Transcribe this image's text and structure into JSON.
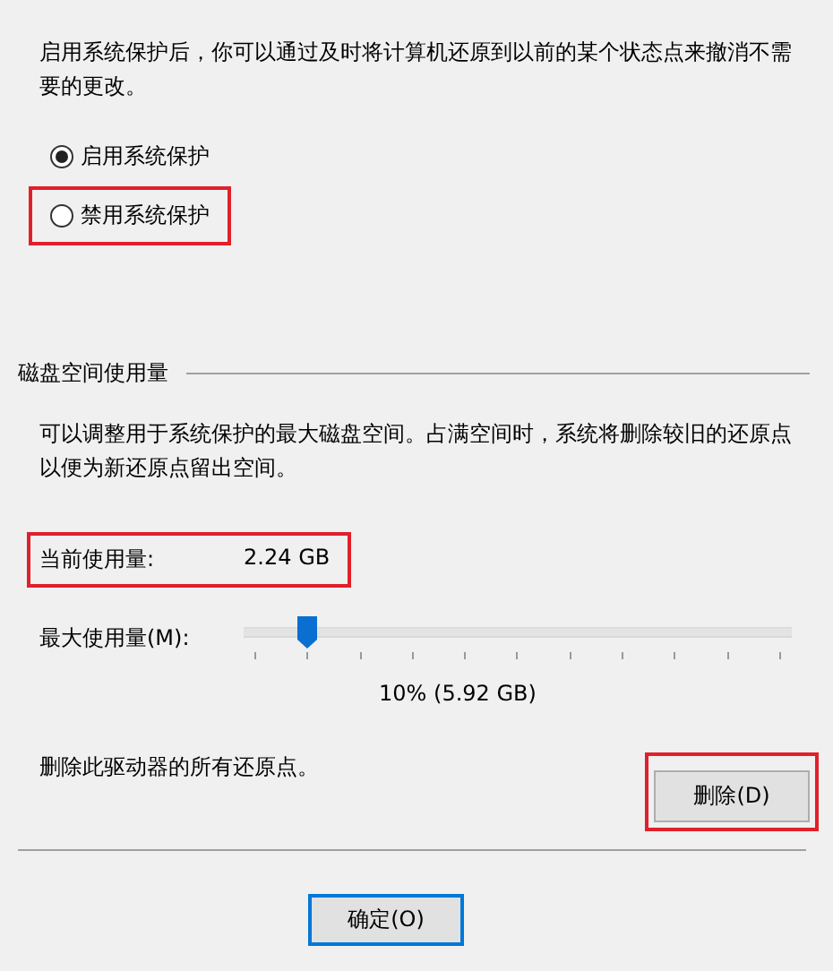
{
  "description": "启用系统保护后，你可以通过及时将计算机还原到以前的某个状态点来撤消不需要的更改。",
  "radios": [
    {
      "label": "启用系统保护",
      "selected": true,
      "highlighted": false
    },
    {
      "label": "禁用系统保护",
      "selected": false,
      "highlighted": true
    }
  ],
  "disk_usage": {
    "heading": "磁盘空间使用量",
    "description": "可以调整用于系统保护的最大磁盘空间。占满空间时，系统将删除较旧的还原点以便为新还原点留出空间。",
    "current_usage": {
      "label": "当前使用量:",
      "value": "2.24 GB",
      "highlighted": true
    },
    "max_usage": {
      "label": "最大使用量(M):",
      "level": 0.1
    },
    "reading": "10% (5.92 GB)",
    "delete_label": "删除此驱动器的所有还原点。",
    "delete_button": {
      "label": "删除(D)",
      "highlighted": true
    }
  },
  "buttons": [
    {
      "label": "确定(O)",
      "default": true
    }
  ]
}
